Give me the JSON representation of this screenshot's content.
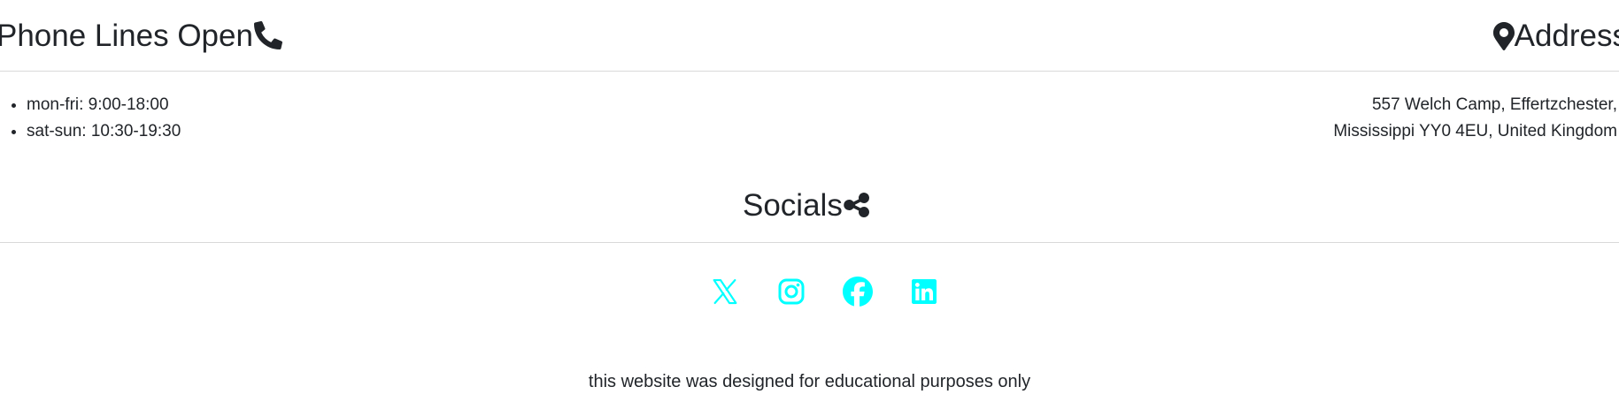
{
  "contact": {
    "phone_heading": "Phone Lines Open",
    "phone_icon": "phone-icon",
    "hours": [
      "mon-fri: 9:00-18:00",
      "sat-sun: 10:30-19:30"
    ],
    "address_heading": "Address",
    "address_icon": "map-pin-icon",
    "address_lines": [
      "557 Welch Camp, Effertzchester,",
      "Mississippi YY0 4EU, United Kingdom"
    ]
  },
  "socials": {
    "heading": "Socials",
    "heading_icon": "share-icon",
    "icon_color": "#00ffff",
    "links": [
      {
        "icon": "x-twitter-icon"
      },
      {
        "icon": "instagram-icon"
      },
      {
        "icon": "facebook-icon"
      },
      {
        "icon": "linkedin-icon"
      }
    ]
  },
  "footer": {
    "note": "this website was designed for educational purposes only"
  },
  "colors": {
    "text": "#212529",
    "divider": "#d9d9d9",
    "accent": "#00ffff"
  }
}
